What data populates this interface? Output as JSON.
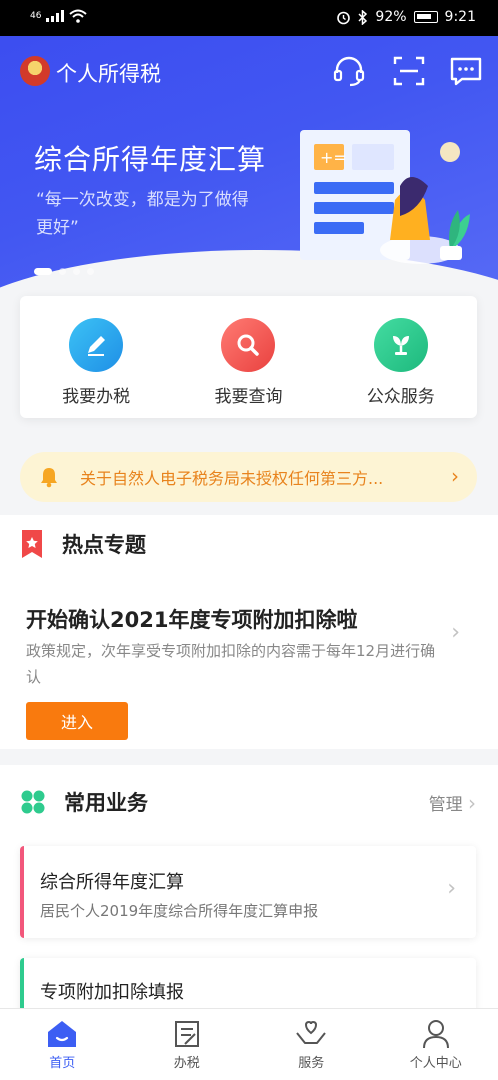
{
  "status_bar": {
    "network": "46",
    "battery": "92%",
    "time": "9:21"
  },
  "app": {
    "title": "个人所得税"
  },
  "banner": {
    "title": "综合所得年度汇算",
    "quote": "“每一次改变，都是为了做得更好”",
    "slide_count": 4,
    "active_slide": 0
  },
  "quick_actions": [
    {
      "label": "我要办税",
      "icon": "pencil-icon",
      "color": "#29a6ef"
    },
    {
      "label": "我要查询",
      "icon": "magnifier-icon",
      "color": "#f05a55"
    },
    {
      "label": "公众服务",
      "icon": "plant-icon",
      "color": "#2ecb8e"
    }
  ],
  "notice": {
    "text": "关于自然人电子税务局未授权任何第三方..."
  },
  "hot_topics": {
    "section_title": "热点专题",
    "item_title": "开始确认2021年度专项附加扣除啦",
    "item_desc": "政策规定，次年享受专项附加扣除的内容需于每年12月进行确认",
    "button_label": "进入"
  },
  "common_services": {
    "section_title": "常用业务",
    "manage_label": "管理",
    "items": [
      {
        "title": "综合所得年度汇算",
        "subtitle": "居民个人2019年度综合所得年度汇算申报",
        "accent": "#f2577b"
      },
      {
        "title": "专项附加扣除填报",
        "subtitle": "",
        "accent": "#2ecb8e"
      }
    ]
  },
  "tab_bar": {
    "tabs": [
      {
        "label": "首页",
        "icon": "home-icon",
        "active": true
      },
      {
        "label": "办税",
        "icon": "document-icon",
        "active": false
      },
      {
        "label": "服务",
        "icon": "heart-hands-icon",
        "active": false
      },
      {
        "label": "个人中心",
        "icon": "user-icon",
        "active": false
      }
    ]
  },
  "colors": {
    "brand_blue": "#3b4cf0",
    "accent_orange": "#f97a0e",
    "notice_bg": "#fdf4d4"
  }
}
